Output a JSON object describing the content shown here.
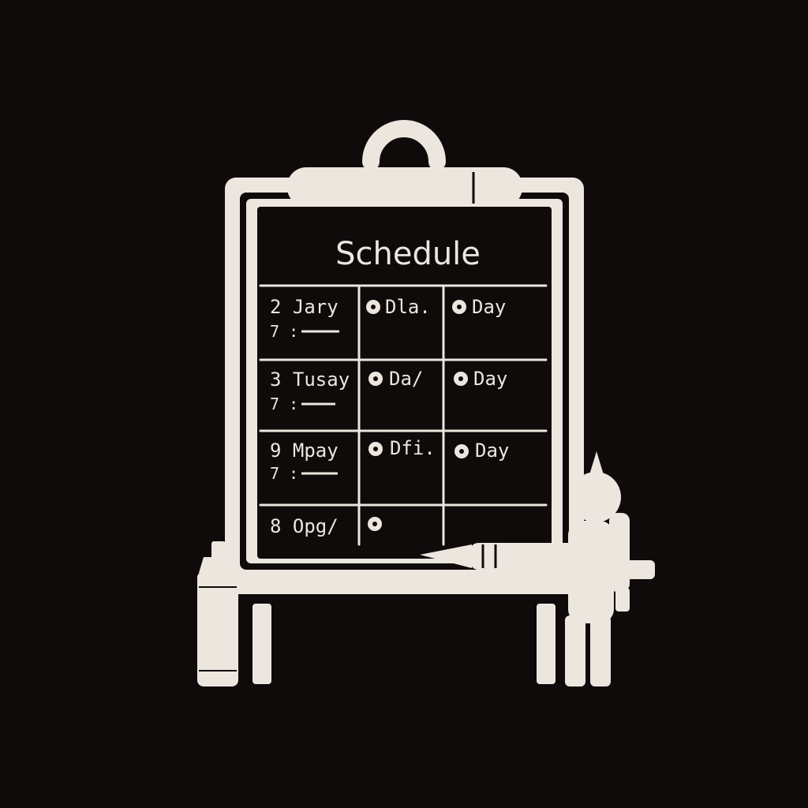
{
  "colors": {
    "background": "#0f0b0b",
    "chalk": "#ece6df",
    "board": "#0f0b0b"
  },
  "board": {
    "title": "Schedule",
    "rows": [
      {
        "label": "2 Jary",
        "sub": "7 :",
        "cells": [
          "Dla.",
          "Day"
        ]
      },
      {
        "label": "3 Tusay",
        "sub": "7 :",
        "cells": [
          "Da/",
          "Day"
        ]
      },
      {
        "label": "9 Mpay",
        "sub": "7 :",
        "cells": [
          "Dfi.",
          "Day"
        ]
      },
      {
        "label": "8 Opg/",
        "sub": "",
        "cells": [
          "",
          ""
        ]
      }
    ]
  },
  "icons": {
    "clip": "clipboard-clip-icon",
    "bullet": "bullet-circle-icon",
    "bottle": "spray-bottle-icon",
    "marker": "marker-pen-icon",
    "figure": "person-figure-icon"
  }
}
